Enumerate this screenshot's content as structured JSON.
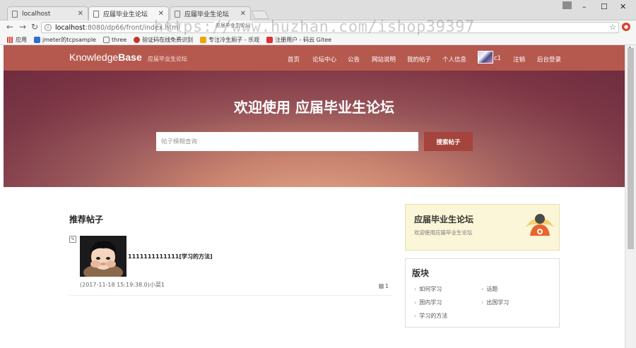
{
  "browser": {
    "tabs": [
      {
        "title": "localhost"
      },
      {
        "title": "应届毕业生论坛"
      },
      {
        "title": "应届毕业生论坛"
      }
    ],
    "tooltip": "应届毕业生论坛",
    "url_host": "localhost",
    "url_path": ":8080/dp66/front/index.html",
    "bookmarks": [
      {
        "label": "应用",
        "icon_color": "#d9432f"
      },
      {
        "label": "jmeter的tcpsample",
        "icon_color": "#2d6fd6"
      },
      {
        "label": "three",
        "icon_color": "#888888"
      },
      {
        "label": "验证码在线免费识别",
        "icon_color": "#c0392b"
      },
      {
        "label": "专注冷生厕子 - 乐观",
        "icon_color": "#f0a400"
      },
      {
        "label": "注册用户 - 码云 Gitee",
        "icon_color": "#d33"
      }
    ]
  },
  "watermark": "https://www.huzhan.com/ishop39397",
  "site": {
    "brand_normal": "Knowledge",
    "brand_bold": "Base",
    "brand_sub": "应届毕业生论坛",
    "nav": [
      {
        "label": "首页"
      },
      {
        "label": "论坛中心"
      },
      {
        "label": "公告"
      },
      {
        "label": "网站说明"
      },
      {
        "label": "我的帖子"
      },
      {
        "label": "个人信息"
      },
      {
        "label": "c1"
      },
      {
        "label": "注销"
      },
      {
        "label": "后台登录"
      }
    ],
    "accent": "#b5594f"
  },
  "hero": {
    "title": "欢迎使用 应届毕业生论坛",
    "search_placeholder": "帖子模糊查询",
    "search_button": "搜索帖子"
  },
  "recommended": {
    "title": "推荐帖子",
    "posts": [
      {
        "title": "1111111111111[学习的方法]",
        "meta": "(2017-11-18 15:19:38.0)小菜1",
        "likes": "1"
      }
    ]
  },
  "sidebar": {
    "forum_title": "应届毕业生论坛",
    "forum_sub": "欢迎使用应届毕业生论坛",
    "board_title": "版块",
    "boards": [
      {
        "label": "如何学习"
      },
      {
        "label": "话题"
      },
      {
        "label": "国内学习"
      },
      {
        "label": "出国学习"
      },
      {
        "label": "学习的方法"
      }
    ]
  }
}
